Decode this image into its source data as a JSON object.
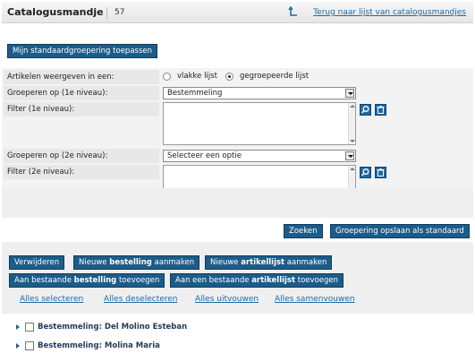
{
  "header": {
    "title": "Catalogusmandje",
    "count": "57",
    "back_link": "Terug naar lijst van catalogusmandjes"
  },
  "apply_default_button": "Mijn standaardgroepering toepassen",
  "form": {
    "display_label": "Artikelen weergeven in een:",
    "flat_list": "vlakke lijst",
    "grouped_list": "gegroepeerde lijst",
    "selected_view": "grouped_list",
    "group1_label": "Groeperen op (1e niveau):",
    "group1_value": "Bestemmeling",
    "filter1_label": "Filter (1e niveau):",
    "group2_label": "Groeperen op (2e niveau):",
    "group2_value": "Selecteer een optie",
    "filter2_label": "Filter (2e niveau):"
  },
  "buttons": {
    "search": "Zoeken",
    "save_default": "Groepering opslaan als standaard",
    "delete": "Verwijderen",
    "new_order_pre": "Nieuwe ",
    "new_order_bold": "bestelling",
    "new_order_post": " aanmaken",
    "new_list_pre": "Nieuwe ",
    "new_list_bold": "artikellijst",
    "new_list_post": " aanmaken",
    "add_order_pre": "Aan bestaande ",
    "add_order_bold": "bestelling",
    "add_order_post": " toevoegen",
    "add_list_pre": "Aan een bestaande ",
    "add_list_bold": "artikellijst",
    "add_list_post": " toevoegen"
  },
  "links": {
    "select_all": "Alles selecteren",
    "deselect_all": "Alles deselecteren",
    "expand_all": "Alles uitvouwen",
    "collapse_all": "Alles samenvouwen"
  },
  "groups": [
    {
      "label": "Bestemmeling: Del Molino Esteban"
    },
    {
      "label": "Bestemmeling: Molina Maria"
    }
  ]
}
